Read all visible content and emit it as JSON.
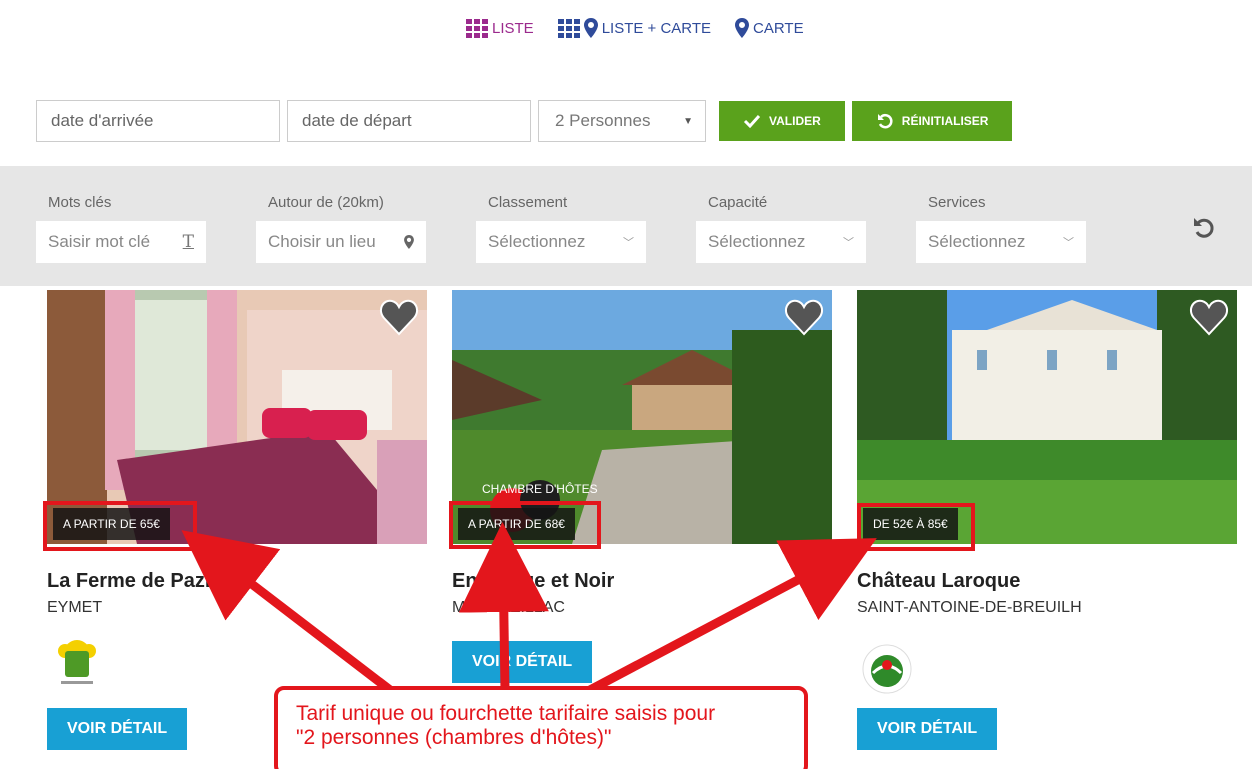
{
  "views": [
    {
      "label": "LISTE",
      "icon": "grid-icon",
      "active": true
    },
    {
      "label": "LISTE + CARTE",
      "icon": "grid-map-pin-icon",
      "active": false
    },
    {
      "label": "CARTE",
      "icon": "map-pin-icon",
      "active": false
    }
  ],
  "search": {
    "arrival_placeholder": "date d'arrivée",
    "departure_placeholder": "date de départ",
    "persons_value": "2 Personnes",
    "validate_label": "VALIDER",
    "reset_label": "RÉINITIALISER"
  },
  "filters": {
    "keywords": {
      "label": "Mots clés",
      "placeholder": "Saisir mot clé"
    },
    "around": {
      "label": "Autour de (20km)",
      "placeholder": "Choisir un lieu"
    },
    "ranking": {
      "label": "Classement",
      "value": "Sélectionnez"
    },
    "capacity": {
      "label": "Capacité",
      "value": "Sélectionnez"
    },
    "services": {
      "label": "Services",
      "value": "Sélectionnez"
    }
  },
  "cards": [
    {
      "title": "La Ferme de Pazier",
      "city": "EYMET",
      "price": "A PARTIR DE 65€",
      "label_logo": "bienvenue-a-la-ferme-logo",
      "button": "VOIR DÉTAIL"
    },
    {
      "title": "En Rouge et Noir",
      "city": "MONBAZILLAC",
      "price": "A PARTIR DE 68€",
      "badge": "CHAMBRE D'HÔTES",
      "button": "VOIR DÉTAIL"
    },
    {
      "title": "Château Laroque",
      "city": "SAINT-ANTOINE-DE-BREUILH",
      "price": "DE 52€ À 85€",
      "label_logo": "accueil-paysan-logo",
      "button": "VOIR DÉTAIL"
    }
  ],
  "annotation": {
    "line1": "Tarif unique ou fourchette tarifaire saisis pour",
    "line2": "\"2 personnes (chambres d'hôtes)\""
  },
  "colors": {
    "accent_green": "#5aa21c",
    "accent_blue": "#18a0d4",
    "annotation_red": "#e3161c",
    "active_view": "#9b2a8d",
    "inactive_view": "#2f4b9a"
  }
}
